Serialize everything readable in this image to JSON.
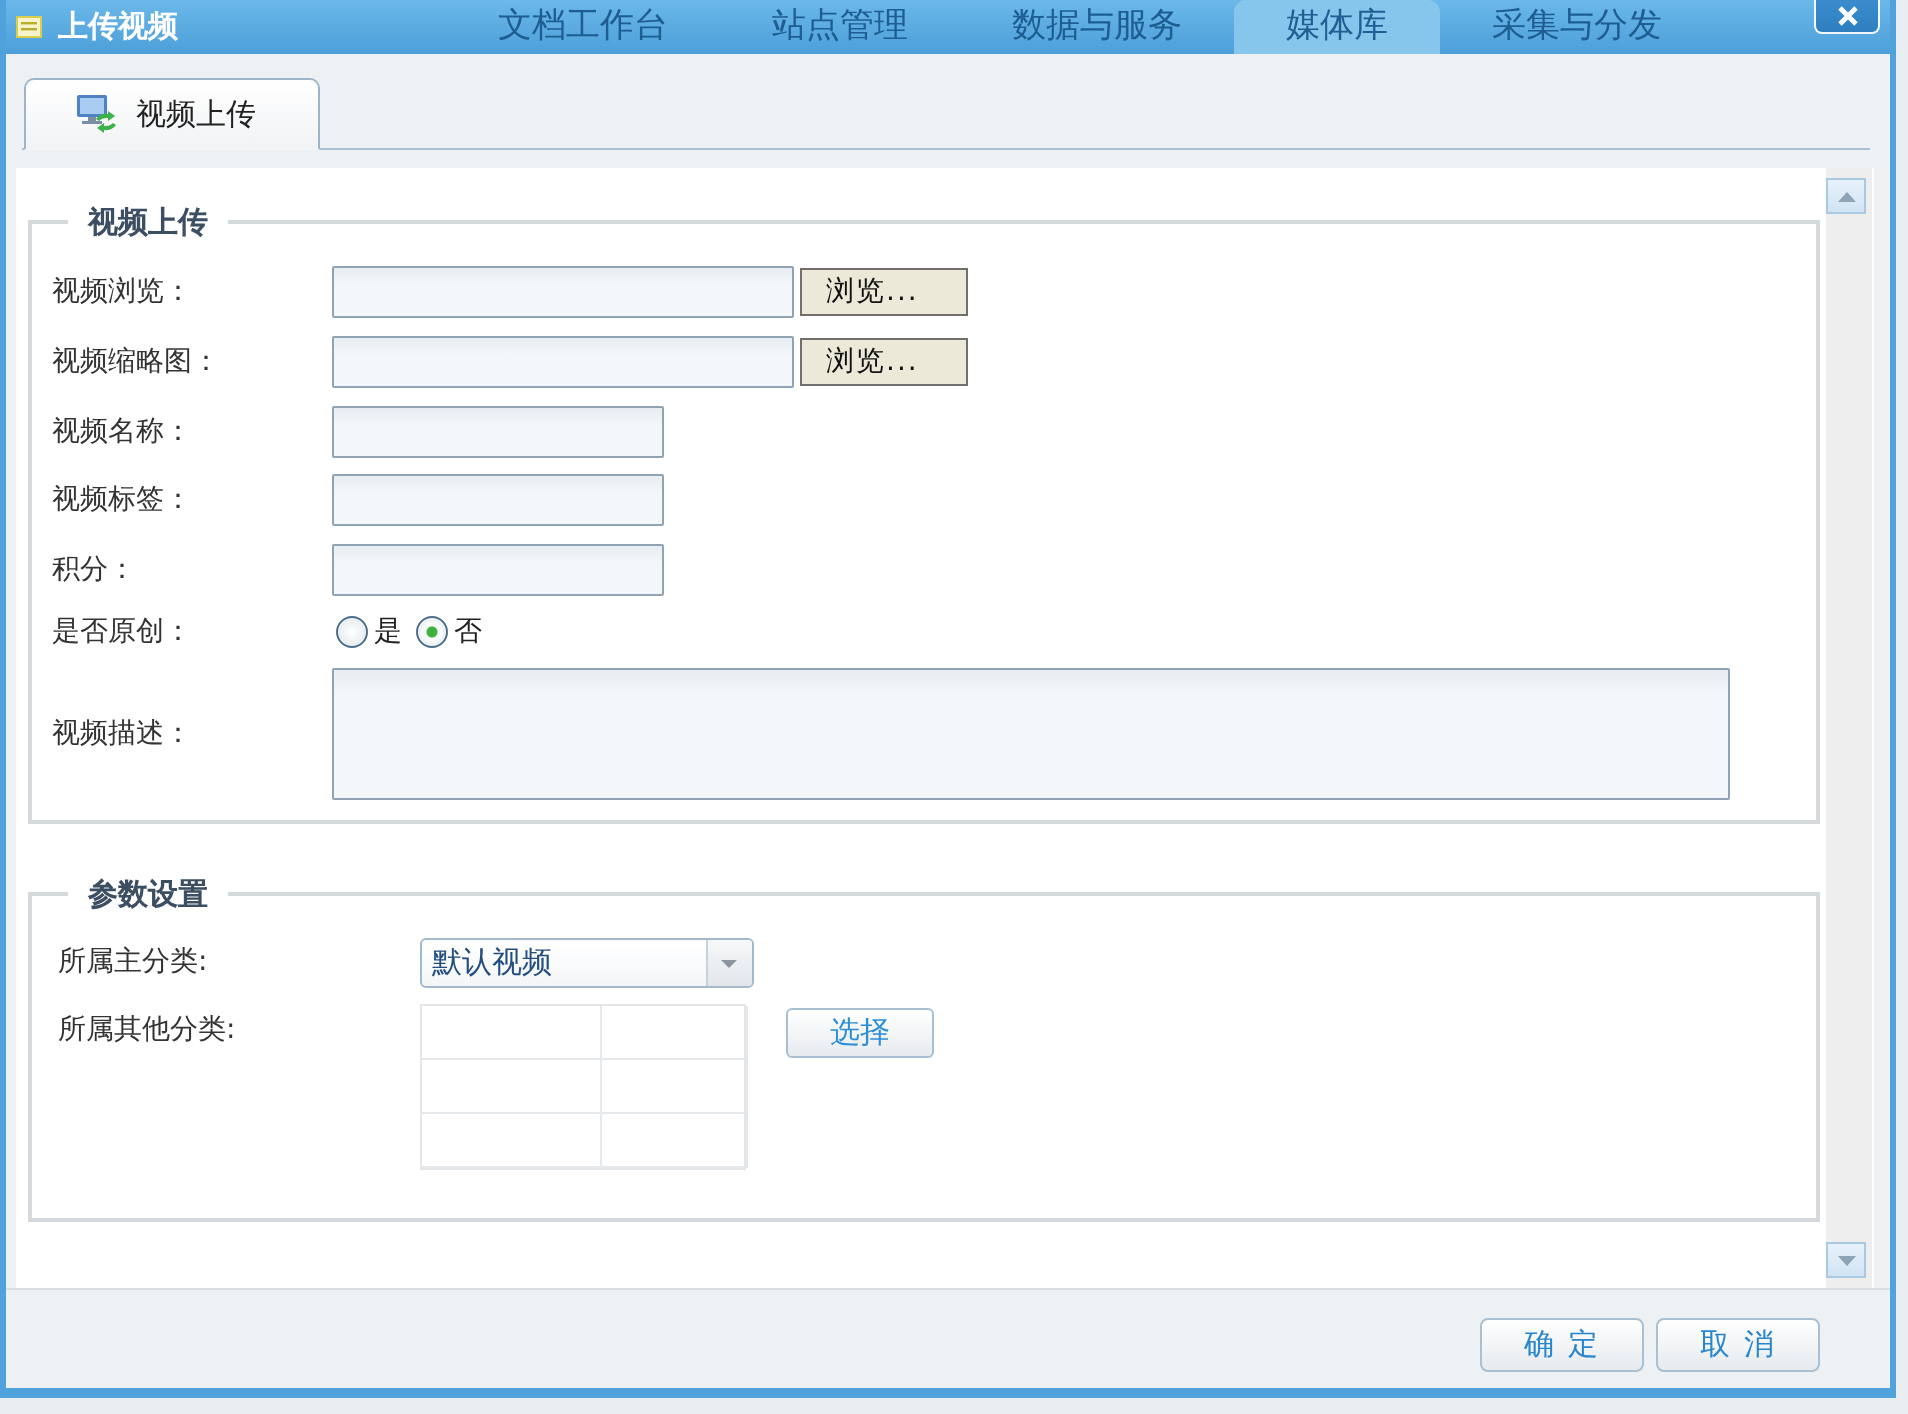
{
  "window": {
    "title": "上传视频"
  },
  "background_nav": [
    {
      "label": "文档工作台",
      "selected": false
    },
    {
      "label": "站点管理",
      "selected": false
    },
    {
      "label": "数据与服务",
      "selected": false
    },
    {
      "label": "媒体库",
      "selected": true
    },
    {
      "label": "采集与分发",
      "selected": false
    }
  ],
  "tabs": [
    {
      "label": "视频上传",
      "selected": true
    }
  ],
  "sections": [
    {
      "legend": "视频上传",
      "fields": [
        {
          "kind": "file",
          "label": "视频浏览：",
          "button": "浏览..."
        },
        {
          "kind": "file",
          "label": "视频缩略图：",
          "button": "浏览..."
        },
        {
          "kind": "text",
          "label": "视频名称："
        },
        {
          "kind": "text",
          "label": "视频标签："
        },
        {
          "kind": "text",
          "label": "积分："
        },
        {
          "kind": "radio",
          "label": "是否原创：",
          "options": [
            {
              "label": "是",
              "selected": false
            },
            {
              "label": "否",
              "selected": true
            }
          ]
        },
        {
          "kind": "textarea",
          "label": "视频描述："
        }
      ]
    },
    {
      "legend": "参数设置",
      "fields": [
        {
          "kind": "select",
          "label": "所属主分类:",
          "value": "默认视频"
        },
        {
          "kind": "picker",
          "label": "所属其他分类:",
          "button": "选择"
        }
      ]
    }
  ],
  "buttons": [
    "确 定",
    "取 消"
  ]
}
